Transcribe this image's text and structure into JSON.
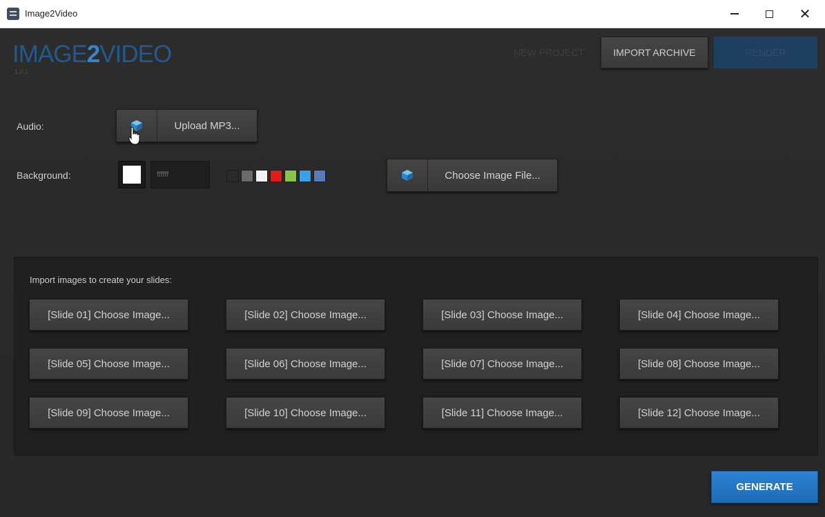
{
  "window": {
    "title": "Image2Video",
    "minimize": "",
    "maximize": "",
    "close": "✕"
  },
  "header": {
    "logo_part1": "IMAGE",
    "logo_part2": "2",
    "logo_part3": "VIDEO",
    "version": "1.0.1",
    "new_project_label": "NEW PROJECT",
    "import_archive_label": "IMPORT ARCHIVE",
    "render_label": "RENDER"
  },
  "audio": {
    "label": "Audio:",
    "upload_button_label": "Upload MP3...",
    "icon": "cube-icon"
  },
  "background": {
    "label": "Background:",
    "hex_value": "ffffff",
    "current_color": "#ffffff",
    "palette": [
      "#2a2a2a",
      "#6a6a6a",
      "#f2f2f2",
      "#e01b1b",
      "#8bc34a",
      "#3aa0e8",
      "#5a7ab8"
    ],
    "choose_image_label": "Choose Image File...",
    "icon": "cube-icon"
  },
  "slides": {
    "title": "Import images to create your slides:",
    "buttons": [
      "[Slide 01] Choose Image...",
      "[Slide 02] Choose Image...",
      "[Slide 03] Choose Image...",
      "[Slide 04] Choose Image...",
      "[Slide 05] Choose Image...",
      "[Slide 06] Choose Image...",
      "[Slide 07] Choose Image...",
      "[Slide 08] Choose Image...",
      "[Slide 09] Choose Image...",
      "[Slide 10] Choose Image...",
      "[Slide 11] Choose Image...",
      "[Slide 12] Choose Image..."
    ]
  },
  "footer": {
    "generate_label": "GENERATE"
  },
  "colors": {
    "accent": "#2d83d3",
    "logo_dark": "#24598c",
    "logo_light": "#3a83c8",
    "background": "#2b2b2b"
  }
}
